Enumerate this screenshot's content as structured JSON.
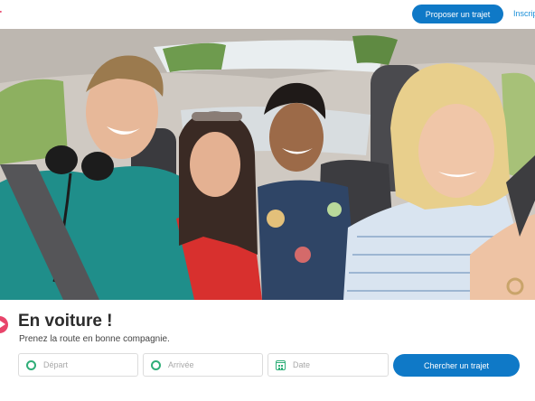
{
  "header": {
    "logo_text": "r",
    "offer_button": "Proposer un trajet",
    "signup_link": "Inscription"
  },
  "hero": {
    "image_description_icon": "hero-photo"
  },
  "search": {
    "title": "En voiture !",
    "subtitle": "Prenez la route en bonne compagnie.",
    "departure_placeholder": "Départ",
    "arrival_placeholder": "Arrivée",
    "date_placeholder": "Date",
    "search_button": "Chercher un trajet"
  },
  "colors": {
    "brand_blue": "#0f79c7",
    "brand_pink": "#e8446a",
    "field_icon_green": "#2fae78"
  }
}
